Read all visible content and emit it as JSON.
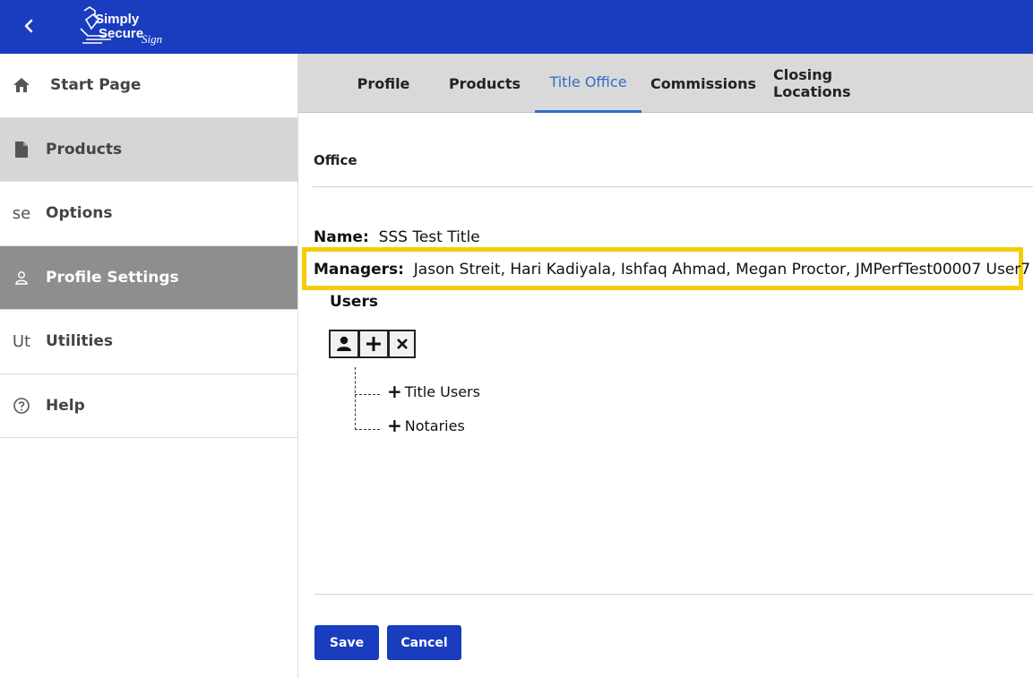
{
  "header": {
    "logo_text": [
      "Simply",
      "Secure",
      "Sign"
    ],
    "back_icon": "chevron-left-icon",
    "colors": {
      "bar": "#1a3dbf"
    }
  },
  "sidebar": {
    "items": [
      {
        "label": "Start Page",
        "icon": "home-icon"
      },
      {
        "label": "Products",
        "icon": "document-icon"
      },
      {
        "label": "Options",
        "icon_text": "se"
      },
      {
        "label": "Profile Settings",
        "icon": "person-icon"
      },
      {
        "label": "Utilities",
        "icon_text": "Ut"
      },
      {
        "label": "Help",
        "icon": "help-circle-icon"
      }
    ]
  },
  "tabs": [
    {
      "label": "Profile"
    },
    {
      "label": "Products"
    },
    {
      "label": "Title Office",
      "active": true
    },
    {
      "label": "Commissions"
    },
    {
      "label": "Closing Locations"
    }
  ],
  "office": {
    "section_title": "Office",
    "name_label": "Name:",
    "name_value": "SSS Test Title",
    "managers_label": "Managers:",
    "managers_value": "Jason Streit, Hari Kadiyala, Ishfaq Ahmad, Megan Proctor, JMPerfTest00007 User7",
    "highlight_color": "#f6cc07"
  },
  "users": {
    "title": "Users",
    "toolbar_icons": [
      "person-icon",
      "plus-icon",
      "close-icon"
    ],
    "tree": [
      {
        "label": "Title Users"
      },
      {
        "label": "Notaries"
      }
    ]
  },
  "actions": {
    "save_label": "Save",
    "cancel_label": "Cancel"
  }
}
